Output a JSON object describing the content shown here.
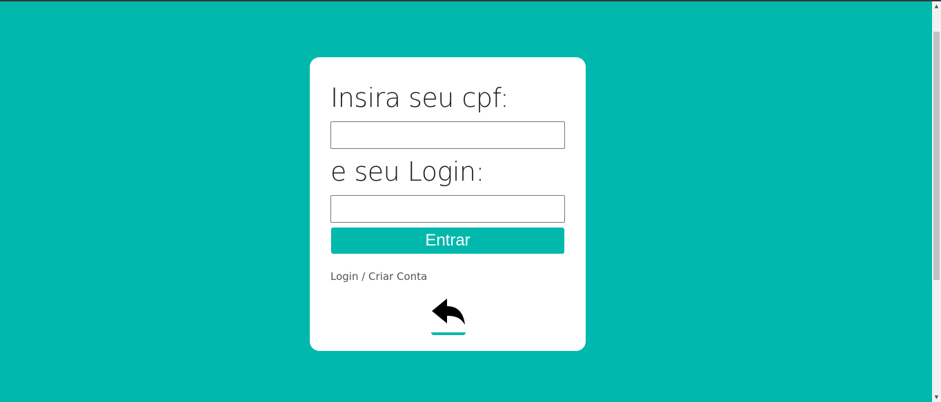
{
  "form": {
    "cpf_label": "Insira seu cpf:",
    "cpf_value": "",
    "login_label": "e seu Login:",
    "login_value": "",
    "submit_label": "Entrar",
    "link_text": "Login / Criar Conta"
  },
  "icons": {
    "back": "reply-arrow-icon",
    "scroll_up": "scroll-up-arrow",
    "scroll_down": "scroll-down-arrow"
  },
  "colors": {
    "background": "#00b8ac",
    "card": "#ffffff",
    "button": "#00b8ac",
    "button_text": "#ffffff"
  }
}
